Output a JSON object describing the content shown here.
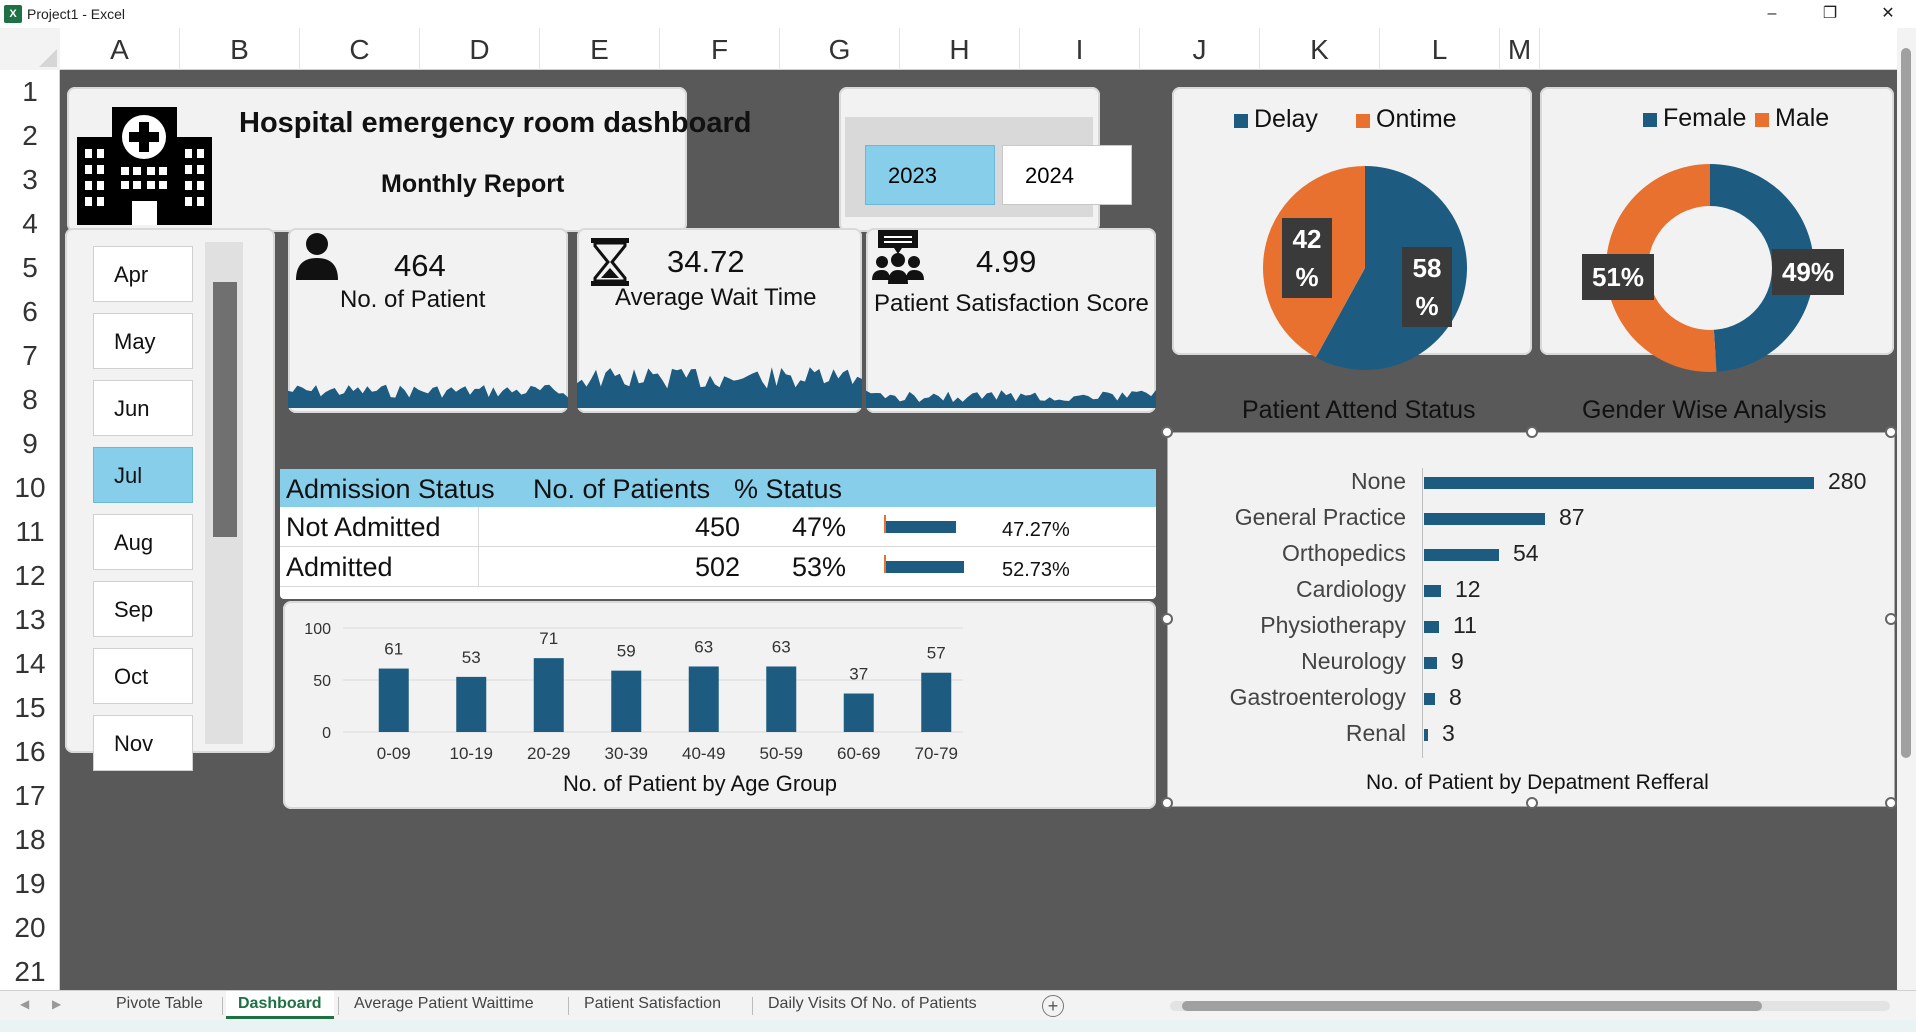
{
  "window": {
    "title": "Project1 - Excel",
    "minimize": "–",
    "restore": "❐",
    "close": "✕",
    "app_icon": "X"
  },
  "columns": [
    "A",
    "B",
    "C",
    "D",
    "E",
    "F",
    "G",
    "H",
    "I",
    "J",
    "K",
    "L",
    "M"
  ],
  "rows": [
    "1",
    "2",
    "3",
    "4",
    "5",
    "6",
    "7",
    "8",
    "9",
    "10",
    "11",
    "12",
    "13",
    "14",
    "15",
    "16",
    "17",
    "18",
    "19",
    "20",
    "21"
  ],
  "header": {
    "title": "Hospital emergency room dashboard",
    "subtitle": "Monthly Report"
  },
  "years": {
    "y2023": "2023",
    "y2024": "2024",
    "selected": "2023"
  },
  "months": {
    "items": [
      "Apr",
      "May",
      "Jun",
      "Jul",
      "Aug",
      "Sep",
      "Oct",
      "Nov"
    ],
    "selected": "Jul"
  },
  "kpis": {
    "patients": {
      "value": "464",
      "label": "No. of Patient",
      "icon": "person-icon"
    },
    "wait": {
      "value": "34.72",
      "label": "Average Wait Time",
      "icon": "hourglass-icon"
    },
    "satisfaction": {
      "value": "4.99",
      "label": "Patient Satisfaction Score",
      "icon": "group-chat-icon"
    }
  },
  "admission": {
    "headers": [
      "Admission Status",
      "No. of Patients",
      "% Status"
    ],
    "rows": [
      {
        "status": "Not Admitted",
        "count": "450",
        "pct": "47%",
        "bar_label": "47.27%",
        "bar_value": 0.4727
      },
      {
        "status": "Admitted",
        "count": "502",
        "pct": "53%",
        "bar_label": "52.73%",
        "bar_value": 0.5273
      }
    ]
  },
  "colors": {
    "accent": "#1d5c80",
    "orange": "#e87130",
    "highlight": "#87ceeb",
    "sheet_bg": "#595959"
  },
  "tabs": {
    "items": [
      "Pivote Table",
      "Dashboard",
      "Average Patient Waittime",
      "Patient Satisfaction",
      "Daily Visits Of No. of Patients"
    ],
    "active": "Dashboard",
    "add": "+"
  },
  "chart_data": [
    {
      "type": "pie",
      "title": "Patient Attend Status",
      "categories": [
        "Delay",
        "Ontime"
      ],
      "values": [
        58,
        42
      ],
      "labels": [
        "58 %",
        "42 %"
      ],
      "colors": [
        "#1d5c80",
        "#e87130"
      ],
      "legend": "top"
    },
    {
      "type": "pie",
      "donut": true,
      "title": "Gender Wise Analysis",
      "categories": [
        "Female",
        "Male"
      ],
      "values": [
        49,
        51
      ],
      "labels": [
        "49%",
        "51%"
      ],
      "colors": [
        "#1d5c80",
        "#e87130"
      ],
      "legend": "top"
    },
    {
      "type": "bar",
      "title": "No. of Patient by Age Group",
      "categories": [
        "0-09",
        "10-19",
        "20-29",
        "30-39",
        "40-49",
        "50-59",
        "60-69",
        "70-79"
      ],
      "values": [
        61,
        53,
        71,
        59,
        63,
        63,
        37,
        57
      ],
      "yticks": [
        "0",
        "50",
        "100"
      ],
      "ylim": [
        0,
        100
      ],
      "grid": true
    },
    {
      "type": "bar",
      "orientation": "horizontal",
      "title": "No. of Patient by Depatment Refferal",
      "categories": [
        "None",
        "General Practice",
        "Orthopedics",
        "Cardiology",
        "Physiotherapy",
        "Neurology",
        "Gastroenterology",
        "Renal"
      ],
      "values": [
        280,
        87,
        54,
        12,
        11,
        9,
        8,
        3
      ]
    }
  ]
}
